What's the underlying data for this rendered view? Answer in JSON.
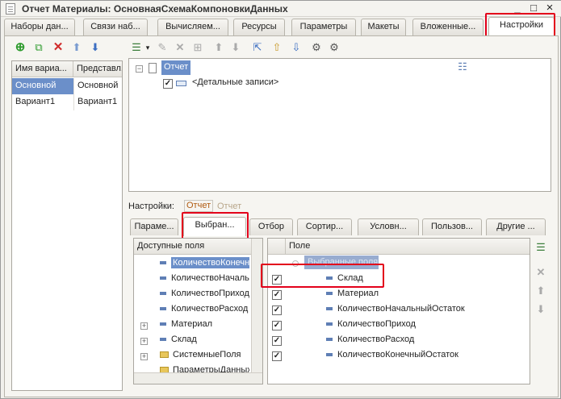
{
  "window": {
    "title": "Отчет Материалы: ОсновнаяСхемаКомпоновкиДанных",
    "minimize": "_",
    "maximize": "□",
    "close": "×"
  },
  "top_tabs": [
    {
      "label": "Наборы дан..."
    },
    {
      "label": "Связи наб..."
    },
    {
      "label": "Вычисляем..."
    },
    {
      "label": "Ресурсы"
    },
    {
      "label": "Параметры"
    },
    {
      "label": "Макеты"
    },
    {
      "label": "Вложенные..."
    },
    {
      "label": "Настройки"
    }
  ],
  "variants": {
    "headers": [
      "Имя вариа...",
      "Представл..."
    ],
    "rows": [
      {
        "name": "Основной",
        "repr": "Основной",
        "selected": true
      },
      {
        "name": "Вариант1",
        "repr": "Вариант1",
        "selected": false
      }
    ]
  },
  "structure": {
    "root": "Отчет",
    "child": "<Детальные записи>"
  },
  "settings": {
    "label": "Настройки:",
    "link_active": "Отчет",
    "link_other": "Отчет"
  },
  "bottom_tabs": [
    {
      "label": "Параме..."
    },
    {
      "label": "Выбран..."
    },
    {
      "label": "Отбор"
    },
    {
      "label": "Сортир..."
    },
    {
      "label": "Условн..."
    },
    {
      "label": "Пользов..."
    },
    {
      "label": "Другие ..."
    }
  ],
  "available_fields": {
    "header": "Доступные поля",
    "items": [
      {
        "label": "КоличествоКонечный",
        "kind": "field",
        "selected": true
      },
      {
        "label": "КоличествоНачальный",
        "kind": "field"
      },
      {
        "label": "КоличествоПриход",
        "kind": "field"
      },
      {
        "label": "КоличествоРасход",
        "kind": "field"
      },
      {
        "label": "Материал",
        "kind": "group"
      },
      {
        "label": "Склад",
        "kind": "group"
      },
      {
        "label": "СистемныеПоля",
        "kind": "folder"
      },
      {
        "label": "ПараметрыДанных",
        "kind": "folder"
      }
    ]
  },
  "selected_fields": {
    "header": "Поле",
    "group": "Выбранные поля",
    "items": [
      {
        "label": "Склад",
        "checked": true
      },
      {
        "label": "Материал",
        "checked": true
      },
      {
        "label": "КоличествоНачальныйОстаток",
        "checked": true
      },
      {
        "label": "КоличествоПриход",
        "checked": true
      },
      {
        "label": "КоличествоРасход",
        "checked": true
      },
      {
        "label": "КоличествоКонечныйОстаток",
        "checked": true
      }
    ]
  },
  "colors": {
    "highlight": "#e3001b",
    "selection": "#6b8fc9"
  }
}
